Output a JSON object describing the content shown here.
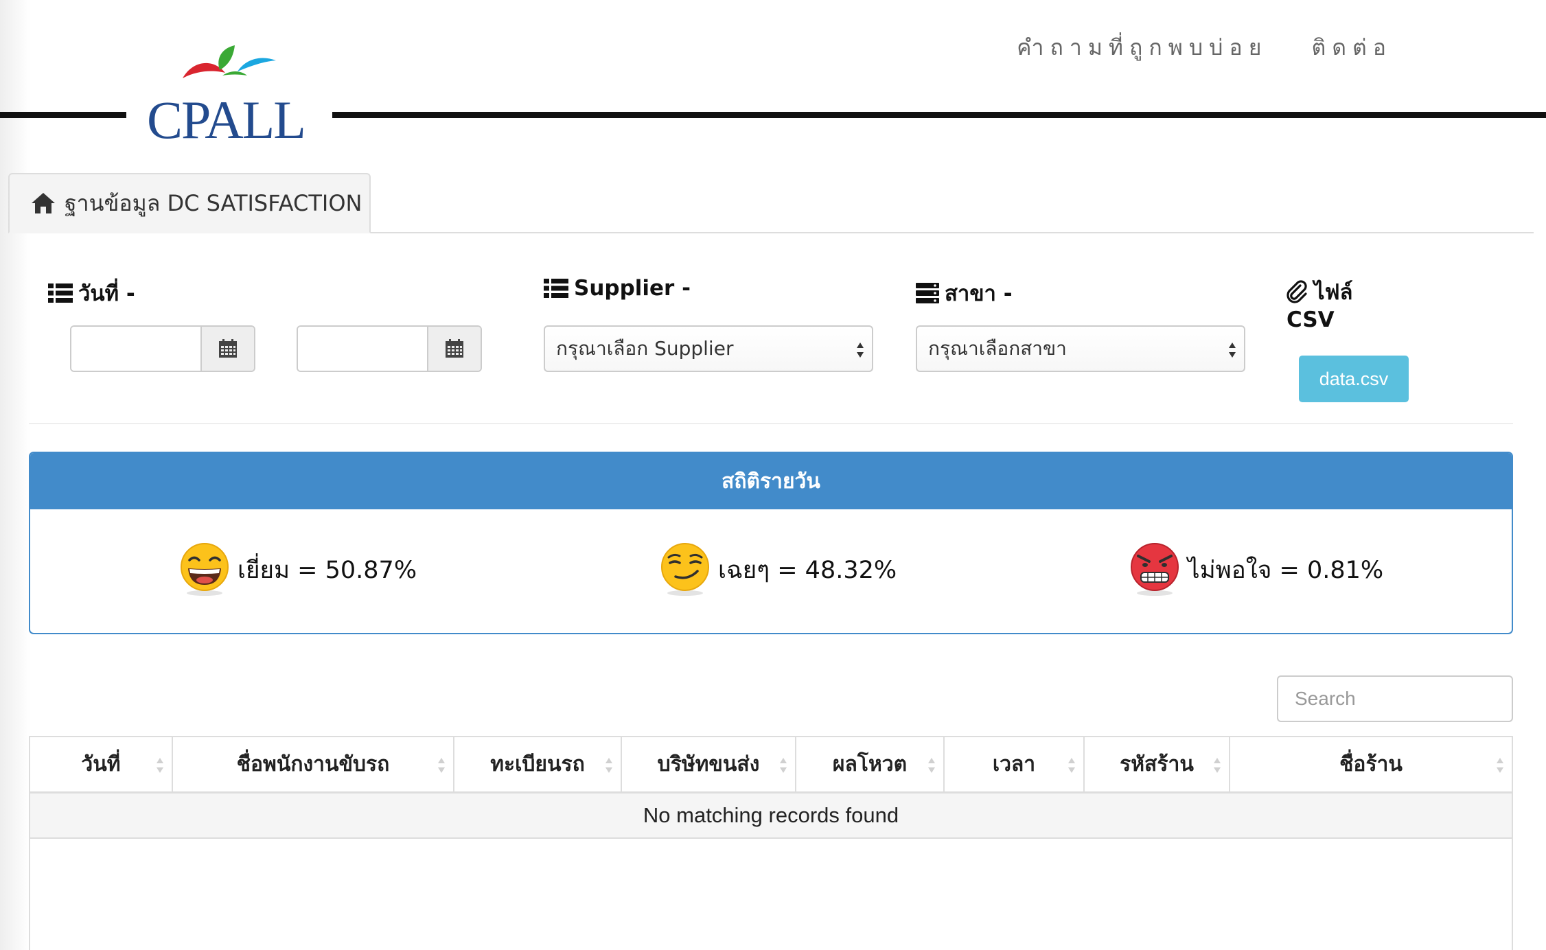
{
  "header": {
    "logo_text": "CPALL",
    "nav": [
      {
        "label": "คำถามที่ถูกพบบ่อย"
      },
      {
        "label": "ติดต่อ"
      }
    ]
  },
  "tab": {
    "label": "ฐานข้อมูล DC SATISFACTION",
    "icon": "home-icon"
  },
  "filters": {
    "date_label": "วันที่ -",
    "date_from_value": "",
    "date_to_value": "",
    "supplier_label": "Supplier -",
    "supplier_selected": "กรุณาเลือก Supplier",
    "branch_label": "สาขา -",
    "branch_selected": "กรุณาเลือกสาขา",
    "file_label": "ไฟล์",
    "file_label_2": "CSV",
    "csv_button": "data.csv"
  },
  "stats": {
    "title": "สถิติรายวัน",
    "items": [
      {
        "label": "เยี่ยม = 50.87%",
        "icon": "laughing-face-icon",
        "percent": 50.87
      },
      {
        "label": "เฉยๆ = 48.32%",
        "icon": "smirking-face-icon",
        "percent": 48.32
      },
      {
        "label": "ไม่พอใจ = 0.81%",
        "icon": "angry-face-icon",
        "percent": 0.81
      }
    ]
  },
  "table": {
    "search_placeholder": "Search",
    "columns": [
      "วันที่",
      "ชื่อพนักงานขับรถ",
      "ทะเบียนรถ",
      "บริษัทขนส่ง",
      "ผลโหวต",
      "เวลา",
      "รหัสร้าน",
      "ชื่อร้าน"
    ],
    "empty_message": "No matching records found"
  },
  "colors": {
    "primary": "#428bca",
    "info": "#5bc0de",
    "logo_blue": "#234b8e",
    "logo_red": "#d9252f",
    "logo_green": "#3aa935",
    "logo_cyan": "#1ba7e0"
  }
}
